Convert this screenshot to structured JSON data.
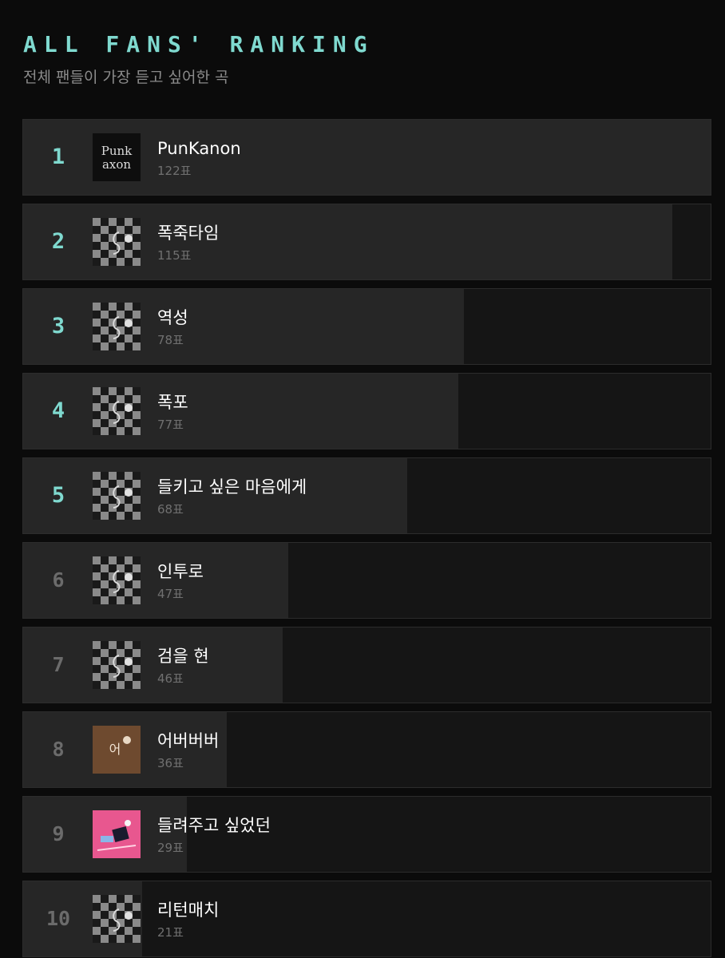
{
  "header": {
    "title": "ALL FANS' RANKING",
    "subtitle": "전체 팬들이 가장 듣고 싶어한 곡"
  },
  "colors": {
    "accent": "#7fd9cf",
    "background": "#0b0b0b",
    "row_background": "#151515",
    "bar_fill": "#262626",
    "muted_text": "#707070"
  },
  "ranking": [
    {
      "rank": "1",
      "title": "PunKanon",
      "votes": "122표",
      "vote_count": 122,
      "cover": "punkanon-cover"
    },
    {
      "rank": "2",
      "title": "폭죽타임",
      "votes": "115표",
      "vote_count": 115,
      "cover": "checkered-cover"
    },
    {
      "rank": "3",
      "title": "역성",
      "votes": "78표",
      "vote_count": 78,
      "cover": "checkered-cover"
    },
    {
      "rank": "4",
      "title": "폭포",
      "votes": "77표",
      "vote_count": 77,
      "cover": "checkered-cover"
    },
    {
      "rank": "5",
      "title": "들키고 싶은 마음에게",
      "votes": "68표",
      "vote_count": 68,
      "cover": "checkered-cover"
    },
    {
      "rank": "6",
      "title": "인투로",
      "votes": "47표",
      "vote_count": 47,
      "cover": "checkered-cover"
    },
    {
      "rank": "7",
      "title": "검을 현",
      "votes": "46표",
      "vote_count": 46,
      "cover": "checkered-cover"
    },
    {
      "rank": "8",
      "title": "어버버버",
      "votes": "36표",
      "vote_count": 36,
      "cover": "brown-cover"
    },
    {
      "rank": "9",
      "title": "들려주고 싶었던",
      "votes": "29표",
      "vote_count": 29,
      "cover": "pink-cover"
    },
    {
      "rank": "10",
      "title": "리턴매치",
      "votes": "21표",
      "vote_count": 21,
      "cover": "checkered-cover"
    }
  ],
  "covers": {
    "punkanon_text_line1": "Punk",
    "punkanon_text_line2": "axon",
    "brown_cover_text": "어"
  }
}
